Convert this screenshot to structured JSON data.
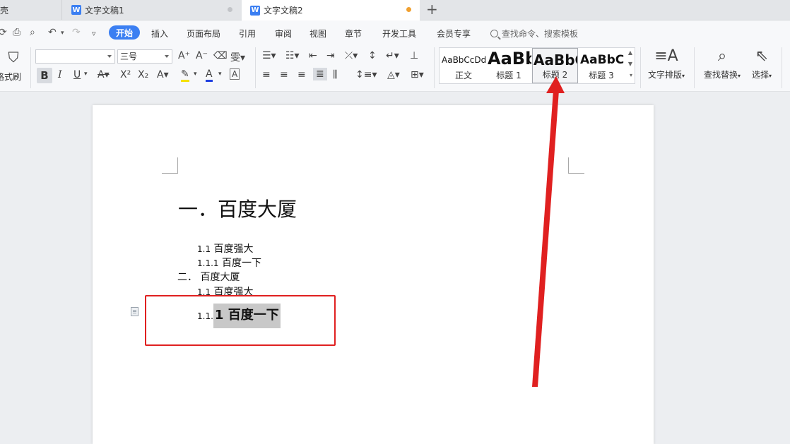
{
  "tabs": {
    "tab0_label": "稻壳",
    "tab1_label": "文字文稿1",
    "tab2_label": "文字文稿2",
    "plus": "+"
  },
  "menu": {
    "items": [
      "开始",
      "插入",
      "页面布局",
      "引用",
      "审阅",
      "视图",
      "章节",
      "开发工具",
      "会员专享"
    ],
    "search_placeholder": "查找命令、搜索模板"
  },
  "ribbon": {
    "format_painter": "格式刷",
    "font_name": "",
    "font_size": "三号",
    "bold": "B",
    "italic": "I",
    "underline": "U",
    "styles": [
      {
        "sample": "AaBbCcDd",
        "label": "正文"
      },
      {
        "sample": "AaBb",
        "label": "标题 1"
      },
      {
        "sample": "AaBbC",
        "label": "标题 2"
      },
      {
        "sample": "AaBbC",
        "label": "标题 3"
      }
    ],
    "text_layout": "文字排版",
    "find_replace": "查找替换",
    "select": "选择"
  },
  "document": {
    "heading1": "一．百度大厦",
    "lines": [
      {
        "num": "1.1",
        "text": "百度强大"
      },
      {
        "num": "1.1.1",
        "text": "百度一下"
      },
      {
        "num": "二．",
        "text": "百度大厦"
      },
      {
        "num": "1.1",
        "text": "百度强大"
      }
    ],
    "selected_prefix": "1.1.",
    "selected_text": "1 百度一下"
  },
  "colors": {
    "accent": "#3b7ff2",
    "annotation_red": "#e02020",
    "modified_dot": "#f0a030"
  }
}
